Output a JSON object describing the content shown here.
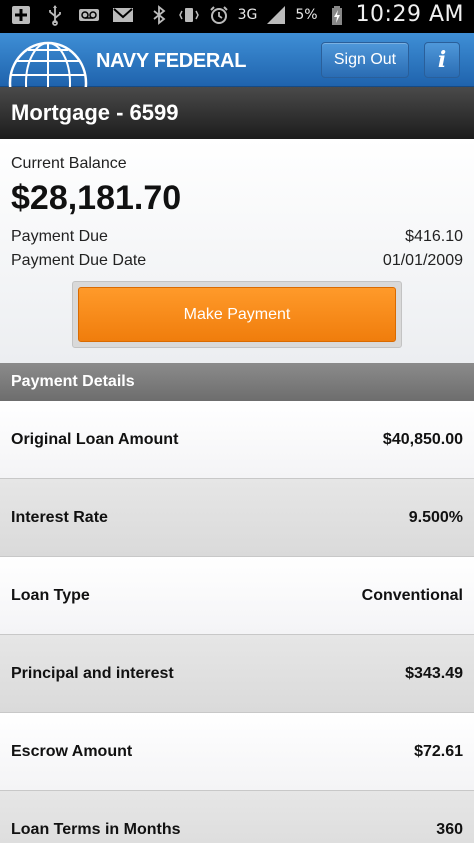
{
  "status_bar": {
    "icons": [
      "plus-icon",
      "usb-icon",
      "voicemail-icon",
      "mail-icon",
      "bluetooth-icon",
      "vibrate-icon",
      "alarm-icon",
      "signal-icon",
      "battery-icon"
    ],
    "network": "3G",
    "battery": "5%",
    "time": "10:29 AM"
  },
  "header": {
    "brand": "NAVY FEDERAL",
    "sign_out_label": "Sign Out",
    "info_label": "i",
    "colors": {
      "bar": "#2b74c2"
    }
  },
  "title": "Mortgage - 6599",
  "balance": {
    "label": "Current Balance",
    "amount": "$28,181.70",
    "payment_due_label": "Payment Due",
    "payment_due_value": "$416.10",
    "payment_due_date_label": "Payment Due Date",
    "payment_due_date_value": "01/01/2009",
    "make_payment_label": "Make Payment",
    "accent": "#f5870f"
  },
  "details": {
    "section_title": "Payment Details",
    "rows": [
      {
        "label": "Original Loan Amount",
        "value": "$40,850.00"
      },
      {
        "label": "Interest Rate",
        "value": "9.500%"
      },
      {
        "label": "Loan Type",
        "value": "Conventional"
      },
      {
        "label": "Principal and interest",
        "value": "$343.49"
      },
      {
        "label": "Escrow Amount",
        "value": "$72.61"
      },
      {
        "label": "Loan Terms in Months",
        "value": "360"
      }
    ]
  }
}
